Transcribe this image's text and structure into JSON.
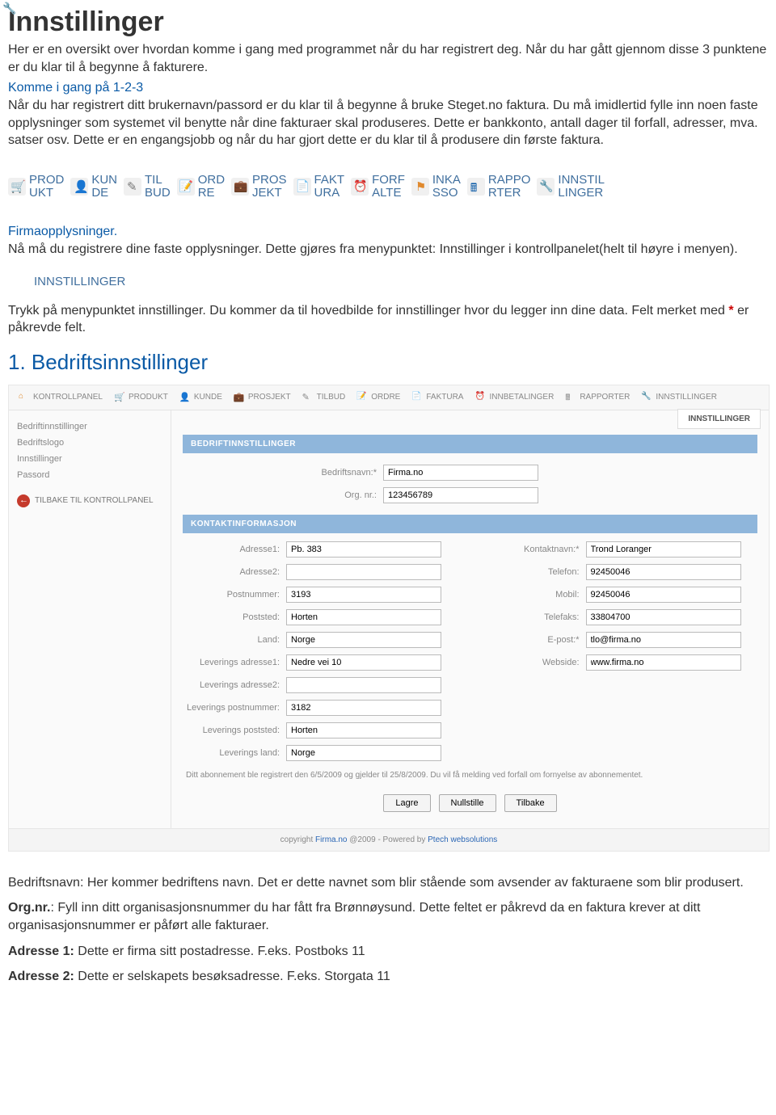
{
  "doc": {
    "title": "Innstillinger",
    "intro": "Her er en oversikt over hvordan komme i gang med programmet når du har registrert deg. Når du har gått gjennom disse 3 punktene er du klar til å begynne å fakturere.",
    "sub1_title": "Komme i gang på 1-2-3",
    "sub1_body": "Når du har registrert ditt brukernavn/passord er du klar til å begynne å bruke Steget.no faktura. Du må imidlertid fylle inn noen faste opplysninger som systemet vil benytte når dine fakturaer skal produseres. Dette er bankkonto, antall dager til forfall, adresser, mva. satser osv. Dette er en engangsjobb og når du har gjort dette er du klar til å produsere din første faktura."
  },
  "nav": [
    {
      "icon": "cart",
      "label": "PRODUKT"
    },
    {
      "icon": "user",
      "label": "KUNDE"
    },
    {
      "icon": "note",
      "label": "TILBUD"
    },
    {
      "icon": "edit",
      "label": "ORDRE"
    },
    {
      "icon": "case",
      "label": "PROSJEKT"
    },
    {
      "icon": "doc",
      "label": "FAKTURA"
    },
    {
      "icon": "clock",
      "label": "FORFALTE"
    },
    {
      "icon": "flag",
      "label": "INKASSO"
    },
    {
      "icon": "calc",
      "label": "RAPPORTER"
    },
    {
      "icon": "wrench",
      "label": "INNSTILLINGER"
    }
  ],
  "section": {
    "title": "Firmaopplysninger.",
    "body": "Nå må du registrere dine faste opplysninger. Dette gjøres fra menypunktet: Innstillinger i kontrollpanelet(helt til høyre i menyen).",
    "wrench_label": "INNSTILLINGER",
    "body2_a": "Trykk på menypunktet innstillinger. Du kommer da til hovedbilde for innstillinger hvor du legger inn dine data. Felt merket med ",
    "body2_red": "*",
    "body2_b": " er påkrevde felt.",
    "heading_1": "1. Bedriftsinnstillinger"
  },
  "panel": {
    "topnav": [
      "KONTROLLPANEL",
      "PRODUKT",
      "KUNDE",
      "PROSJEKT",
      "TILBUD",
      "ORDRE",
      "FAKTURA",
      "INNBETALINGER",
      "RAPPORTER",
      "INNSTILLINGER"
    ],
    "topnav_icons": [
      "home",
      "cart",
      "user",
      "case",
      "note",
      "edit",
      "doc",
      "clock",
      "calc",
      "wrench"
    ],
    "side": {
      "items": [
        "Bedriftinnstillinger",
        "Bedriftslogo",
        "Innstillinger",
        "Passord"
      ],
      "back": "TILBAKE TIL KONTROLLPANEL"
    },
    "tabright": "INNSTILLINGER",
    "bar1": "BEDRIFTINNSTILLINGER",
    "top_fields": {
      "bedriftsnavn_label": "Bedriftsnavn:*",
      "bedriftsnavn": "Firma.no",
      "orgnr_label": "Org. nr.:",
      "orgnr": "123456789"
    },
    "bar2": "KONTAKTINFORMASJON",
    "left": [
      {
        "label": "Adresse1:",
        "value": "Pb. 383"
      },
      {
        "label": "Adresse2:",
        "value": ""
      },
      {
        "label": "Postnummer:",
        "value": "3193"
      },
      {
        "label": "Poststed:",
        "value": "Horten"
      },
      {
        "label": "Land:",
        "value": "Norge"
      },
      {
        "label": "Leverings adresse1:",
        "value": "Nedre vei 10"
      },
      {
        "label": "Leverings adresse2:",
        "value": ""
      },
      {
        "label": "Leverings postnummer:",
        "value": "3182"
      },
      {
        "label": "Leverings poststed:",
        "value": "Horten"
      },
      {
        "label": "Leverings land:",
        "value": "Norge"
      }
    ],
    "right": [
      {
        "label": "Kontaktnavn:*",
        "value": "Trond Loranger"
      },
      {
        "label": "Telefon:",
        "value": "92450046"
      },
      {
        "label": "Mobil:",
        "value": "92450046"
      },
      {
        "label": "Telefaks:",
        "value": "33804700"
      },
      {
        "label": "E-post:*",
        "value": "tlo@firma.no"
      },
      {
        "label": "Webside:",
        "value": "www.firma.no"
      }
    ],
    "note": "Ditt abonnement ble registrert den 6/5/2009 og gjelder til 25/8/2009. Du vil få melding ved forfall om fornyelse av abonnementet.",
    "buttons": [
      "Lagre",
      "Nullstille",
      "Tilbake"
    ],
    "footer_a": "copyright ",
    "footer_link1": "Firma.no",
    "footer_b": " @2009    -    Powered by ",
    "footer_link2": "Ptech websolutions"
  },
  "post": {
    "p1_a": "Bedriftsnavn: ",
    "p1_b": "Her kommer bedriftens navn. Det er dette navnet som blir stående som avsender av fakturaene som blir produsert.",
    "p2_a": "Org.nr.",
    "p2_b": ": Fyll inn ditt organisasjonsnummer du har fått fra Brønnøysund. Dette feltet er påkrevd da en faktura krever at ditt organisasjonsnummer er påført alle fakturaer.",
    "p3_a": "Adresse 1:",
    "p3_b": " Dette er firma sitt postadresse. F.eks. Postboks 11",
    "p4_a": "Adresse 2:",
    "p4_b": " Dette er selskapets besøksadresse. F.eks. Storgata 11"
  }
}
